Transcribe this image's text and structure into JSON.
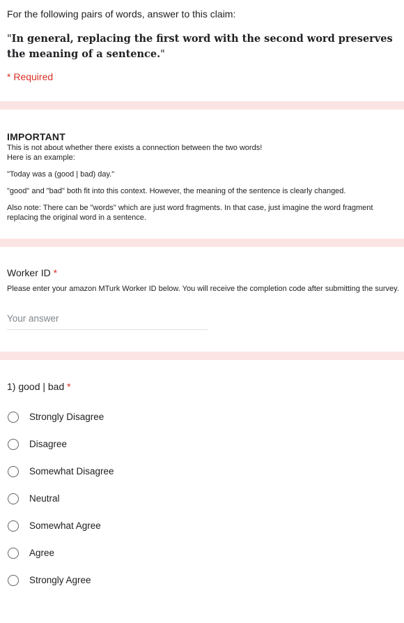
{
  "intro": {
    "instruction": "For the following pairs of words, answer to this claim:",
    "claim_open_quote": "\"",
    "claim_bold": "In general, replacing the first word with the second word preserves the meaning of a sentence.",
    "claim_close_quote": "\"",
    "required_note": "* Required"
  },
  "important": {
    "title": "IMPORTANT",
    "line1": "This is not about whether there exists a connection between the two words!",
    "line2": "Here is an example:",
    "example": "\"Today was a (good | bad) day.\"",
    "explanation": "\"good\" and \"bad\" both fit into this context. However, the meaning of the sentence is clearly changed.",
    "note": "Also note: There can be \"words\" which are just word fragments. In that case, just imagine the word fragment replacing the original word in a sentence."
  },
  "worker": {
    "title": "Worker ID",
    "required_star": "*",
    "help": "Please enter your amazon MTurk Worker ID below. You will receive the completion code after submitting the survey.",
    "placeholder": "Your answer"
  },
  "question1": {
    "title": "1) good | bad",
    "required_star": "*",
    "options": [
      "Strongly Disagree",
      "Disagree",
      "Somewhat Disagree",
      "Neutral",
      "Somewhat Agree",
      "Agree",
      "Strongly Agree"
    ]
  },
  "colors": {
    "section_band": "#fce4e4",
    "required_red": "#d93025",
    "text": "#202124",
    "placeholder": "#80868b"
  }
}
